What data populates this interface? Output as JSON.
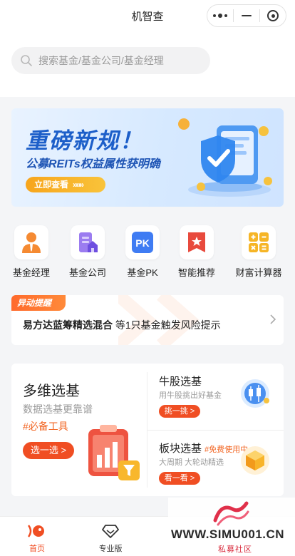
{
  "app": {
    "title": "机智查"
  },
  "search": {
    "placeholder": "搜索基金/基金公司/基金经理"
  },
  "banner": {
    "headline": "重磅新规！",
    "subline": "公募REITs权益属性获明确",
    "cta_label": "立即查看",
    "cta_arrows": "»»»"
  },
  "quick_icons": [
    {
      "label": "基金经理",
      "icon": "fund-manager-icon"
    },
    {
      "label": "基金公司",
      "icon": "fund-company-icon"
    },
    {
      "label": "基金PK",
      "icon": "fund-pk-icon",
      "glyph": "PK"
    },
    {
      "label": "智能推荐",
      "icon": "smart-recommend-icon"
    },
    {
      "label": "财富计算器",
      "icon": "calculator-icon"
    }
  ],
  "alert": {
    "tag": "异动提醒",
    "fund_name": "易方达蓝筹精选混合",
    "message": "等1只基金触发风险提示"
  },
  "multi_select": {
    "title": "多维选基",
    "subtitle": "数据选基更靠谱",
    "tag": "#必备工具",
    "button": "选一选 >",
    "tools": [
      {
        "title": "牛股选基",
        "badge": "",
        "subtitle": "用牛股挑出好基金",
        "button": "挑一挑 >",
        "icon": "candlestick-icon"
      },
      {
        "title": "板块选基",
        "badge": "#免费使用中",
        "subtitle": "大周期 大轮动精选",
        "button": "看一看 >",
        "icon": "cube-icon"
      }
    ]
  },
  "tabbar": [
    {
      "label": "首页",
      "active": true
    },
    {
      "label": "专业版",
      "active": false
    }
  ],
  "watermark": {
    "url": "WWW.SIMU001.CN",
    "name": "私募社区"
  },
  "colors": {
    "accent": "#f04e23",
    "banner_blue": "#1d5fc9",
    "cta_orange": "#f7a51c"
  }
}
